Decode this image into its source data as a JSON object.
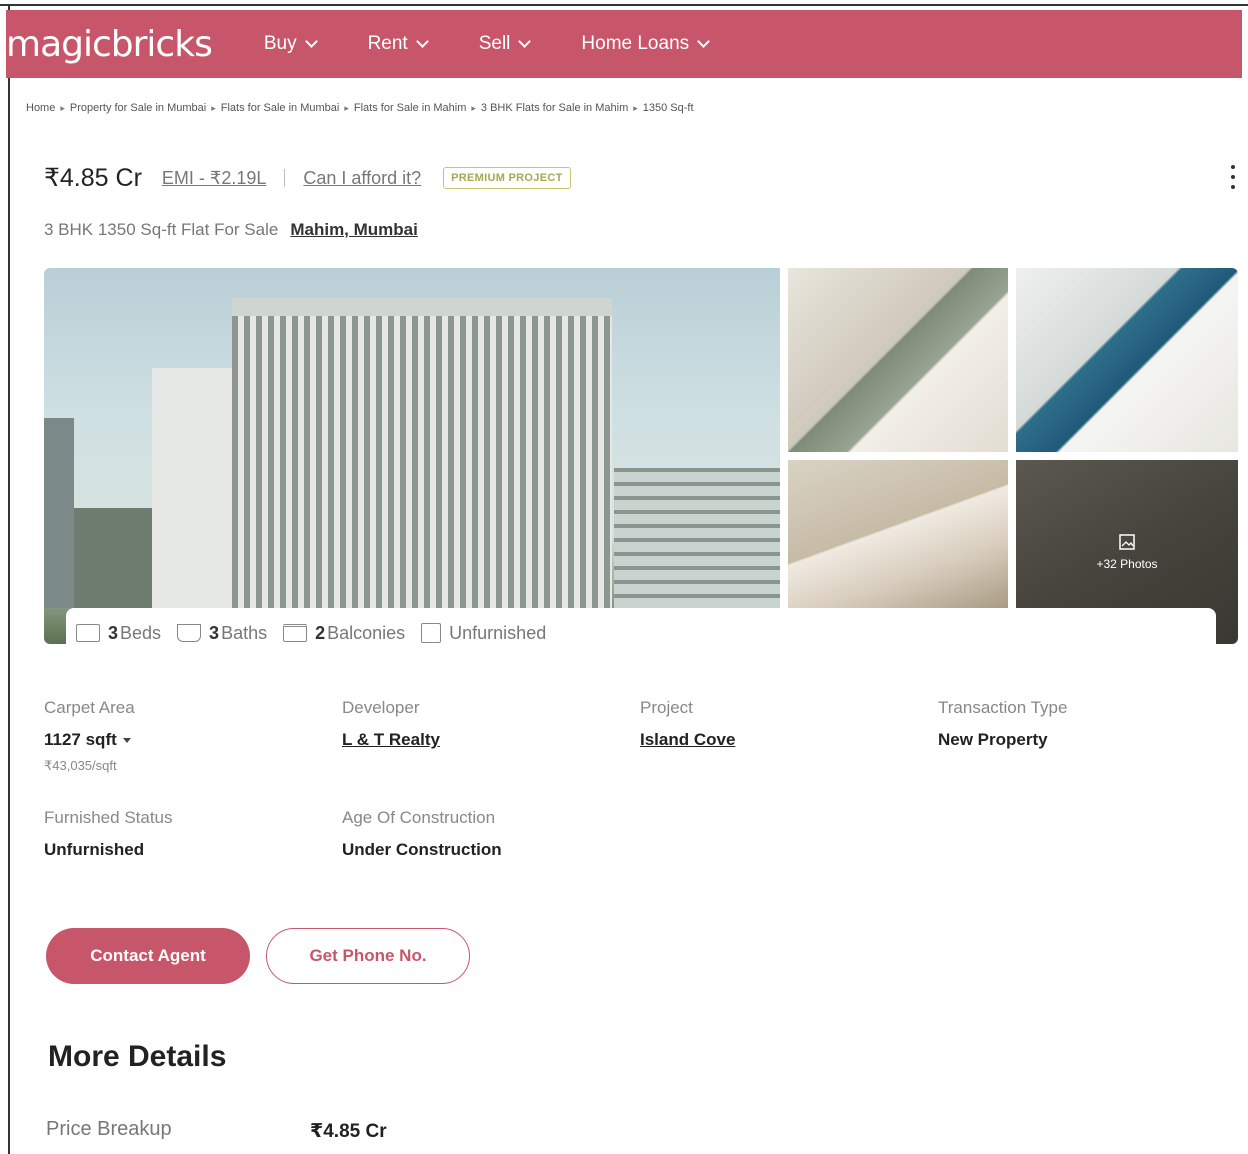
{
  "header": {
    "logo": "magicbricks",
    "nav": [
      {
        "label": "Buy"
      },
      {
        "label": "Rent"
      },
      {
        "label": "Sell"
      },
      {
        "label": "Home Loans"
      }
    ]
  },
  "breadcrumb": [
    "Home",
    "Property for Sale in Mumbai",
    "Flats for Sale in Mumbai",
    "Flats for Sale in Mahim",
    "3 BHK Flats for Sale in Mahim",
    "1350 Sq-ft"
  ],
  "listing": {
    "price": "₹4.85 Cr",
    "emi": "EMI - ₹2.19L",
    "afford": "Can I afford it?",
    "badge": "PREMIUM PROJECT",
    "subtitle": "3 BHK 1350 Sq-ft Flat For Sale",
    "location": "Mahim, Mumbai"
  },
  "gallery": {
    "more_photos": "+32 Photos"
  },
  "features": {
    "beds_num": "3",
    "beds_label": "Beds",
    "baths_num": "3",
    "baths_label": "Baths",
    "balc_num": "2",
    "balc_label": "Balconies",
    "furnishing": "Unfurnished"
  },
  "details": {
    "carpet_label": "Carpet Area",
    "carpet_value": "1127 sqft",
    "carpet_rate": "₹43,035/sqft",
    "developer_label": "Developer",
    "developer_value": "L & T Realty",
    "project_label": "Project",
    "project_value": "Island Cove",
    "transaction_label": "Transaction Type",
    "transaction_value": "New Property",
    "furnished_label": "Furnished Status",
    "furnished_value": "Unfurnished",
    "age_label": "Age Of Construction",
    "age_value": "Under Construction"
  },
  "actions": {
    "contact": "Contact Agent",
    "phone": "Get Phone No."
  },
  "more": {
    "title": "More Details",
    "price_breakup_label": "Price Breakup",
    "price_breakup_value": "₹4.85 Cr"
  },
  "colors": {
    "brand": "#c8566b",
    "badge": "#c9c470"
  }
}
